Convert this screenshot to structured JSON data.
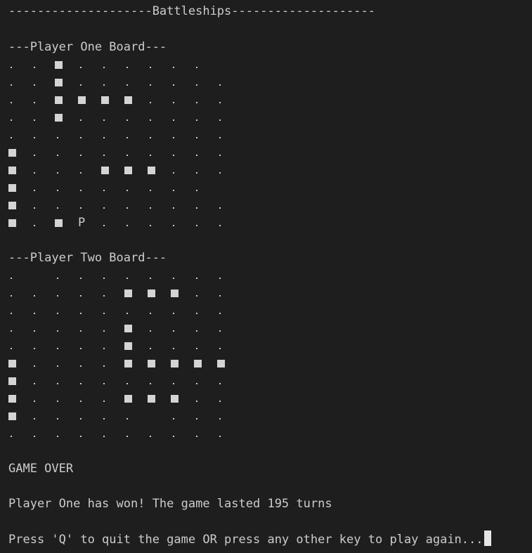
{
  "title": "--------------------Battleships--------------------",
  "player_one_board": {
    "label": "---Player One Board---",
    "rows": [
      ". . ■ . . . . . .  ",
      ". . ■ . . . . . . .",
      ". . ■ ■ ■ ■ . . . .",
      ". . ■ . . . . . . .",
      ". . . . . . . . . .",
      "■ . . . . . . . . .",
      "■ . . . ■ ■ ■ . . .",
      "■ . . . . . . . .  ",
      "■ . . . . . . . . .",
      "■ . ■ P . . . . . ."
    ]
  },
  "player_two_board": {
    "label": "---Player Two Board---",
    "rows": [
      ".   . . . . . . . .",
      ". . . . . ■ ■ ■ . .",
      ". . . . . . . . . .",
      ". . . . . ■ . . . .",
      ". . . . . ■ . . . .",
      "■ . . . . ■ ■ ■ ■ ■",
      "■ . . . . . . . . .",
      "■ . . . . ■ ■ ■ . .",
      "■ . . . . .   . . .",
      ". . . . . . . . . ."
    ]
  },
  "game_over_text": "GAME OVER",
  "result_text": "Player One has won! The game lasted 195 turns",
  "prompt_text": "Press 'Q' to quit the game OR press any other key to play again..."
}
